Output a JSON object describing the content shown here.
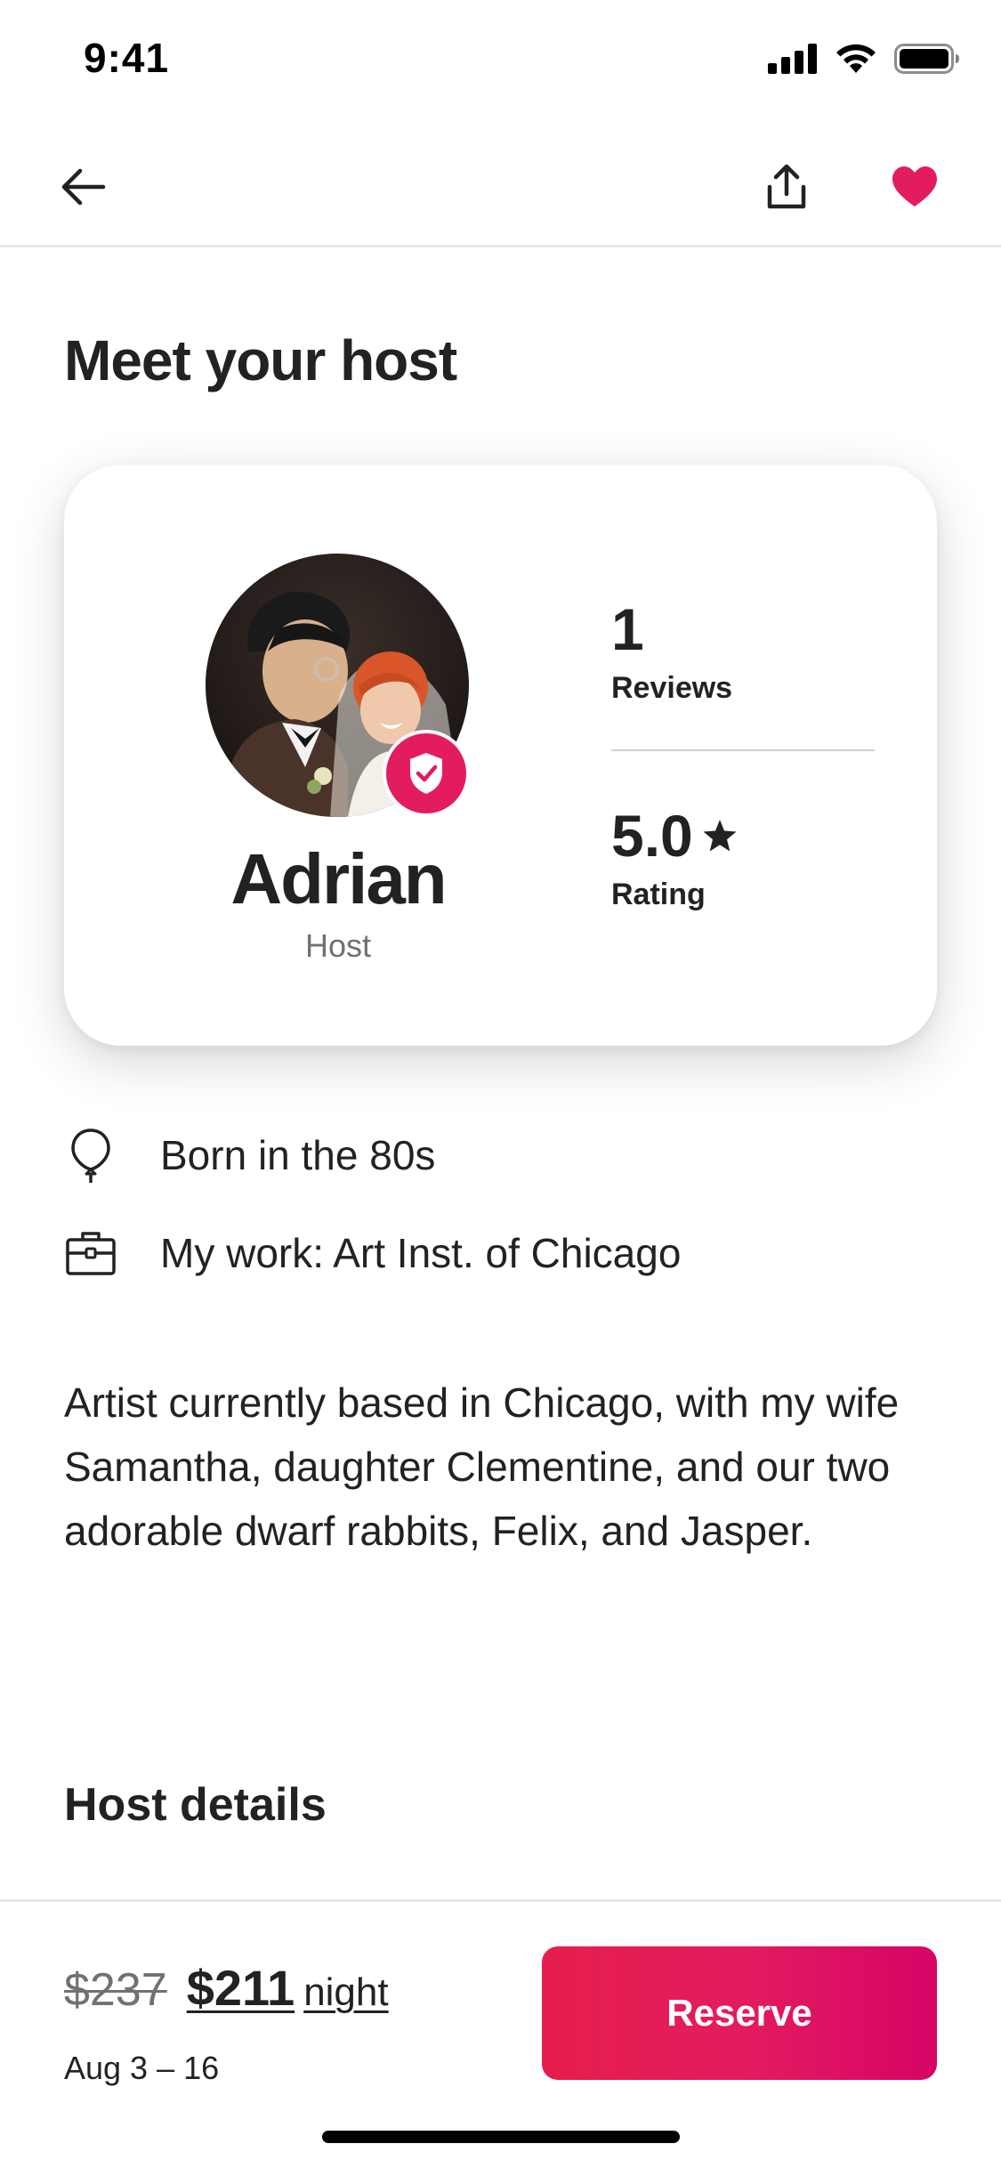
{
  "status_bar": {
    "time": "9:41"
  },
  "icons": {
    "back": "arrow-left-icon",
    "share": "share-icon",
    "save": "heart-icon",
    "verified": "shield-check-icon",
    "born": "balloon-icon",
    "work": "briefcase-icon",
    "star": "star-icon"
  },
  "colors": {
    "accent": "#e31c5f",
    "text": "#222222",
    "muted": "#717171"
  },
  "page": {
    "title": "Meet your host"
  },
  "host": {
    "name": "Adrian",
    "role": "Host",
    "reviews_count": "1",
    "reviews_label": "Reviews",
    "rating_value": "5.0",
    "rating_label": "Rating"
  },
  "facts": [
    {
      "icon": "balloon-icon",
      "text": "Born in the 80s"
    },
    {
      "icon": "briefcase-icon",
      "text": "My work: Art Inst. of Chicago"
    }
  ],
  "bio": "Artist currently based in Chicago, with my wife Samantha, daughter Clementine, and our two adorable dwarf rabbits, Felix, and Jasper.",
  "sections": {
    "host_details": "Host details"
  },
  "footer": {
    "price_original": "$237",
    "price_current": "$211",
    "price_unit": "night",
    "dates": "Aug 3 – 16",
    "reserve_label": "Reserve"
  }
}
